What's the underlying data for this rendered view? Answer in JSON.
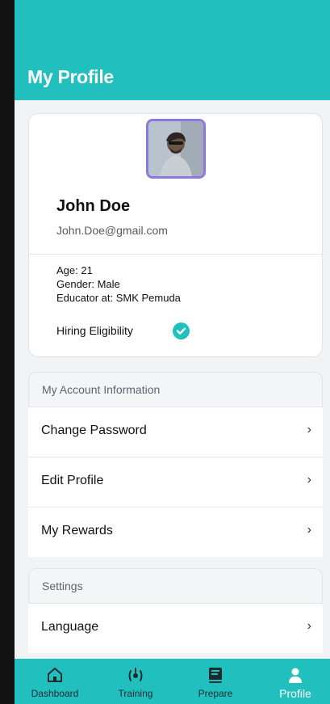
{
  "header": {
    "title": "My Profile"
  },
  "profile": {
    "name": "John Doe",
    "email": "John.Doe@gmail.com",
    "age": "Age: 21",
    "gender": "Gender: Male",
    "educator": "Educator at: SMK Pemuda",
    "hiring_label": "Hiring Eligibility",
    "hiring_eligible": true
  },
  "account_section": {
    "title": "My Account Information",
    "items": [
      {
        "label": "Change Password",
        "icon": "chevron-right-icon"
      },
      {
        "label": "Edit Profile",
        "icon": "chevron-right-icon"
      },
      {
        "label": "My Rewards",
        "icon": "chevron-right-icon"
      }
    ]
  },
  "settings_section": {
    "title": "Settings",
    "items": [
      {
        "label": "Language",
        "icon": "chevron-right-icon"
      }
    ]
  },
  "navbar": {
    "items": [
      {
        "label": "Dashboard",
        "icon": "home-icon",
        "active": false
      },
      {
        "label": "Training",
        "icon": "training-icon",
        "active": false
      },
      {
        "label": "Prepare",
        "icon": "book-icon",
        "active": false
      },
      {
        "label": "Profile",
        "icon": "person-icon",
        "active": true
      }
    ]
  },
  "colors": {
    "primary": "#22bfbf",
    "avatar_border": "#8a78e4",
    "background": "#f2f3f5"
  }
}
